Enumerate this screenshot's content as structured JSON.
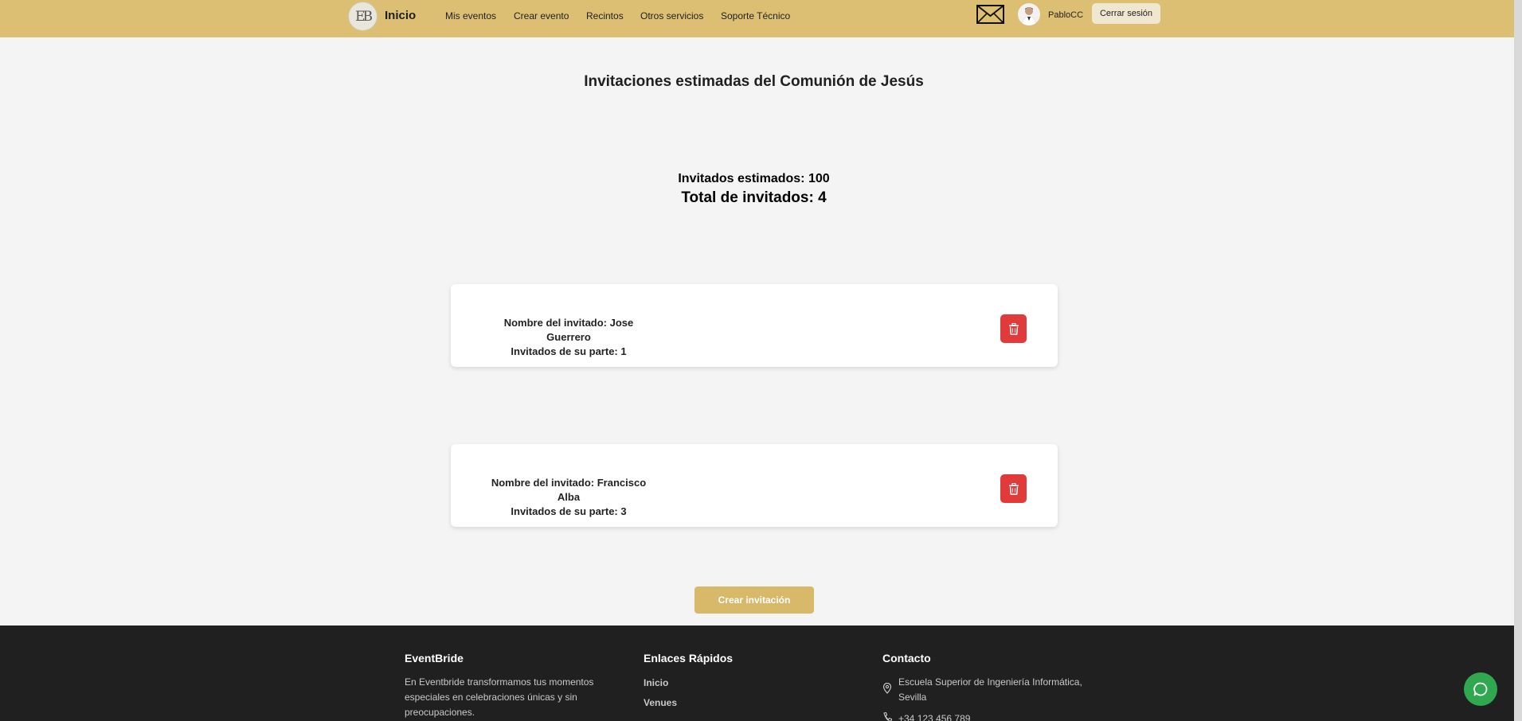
{
  "nav": {
    "logo_text": "EB",
    "home": "Inicio",
    "links": [
      "Mis eventos",
      "Crear evento",
      "Recintos",
      "Otros servicios",
      "Soporte Técnico"
    ],
    "username": "PabloCC",
    "logout": "Cerrar sesión"
  },
  "main": {
    "title": "Invitaciones estimadas del Comunión de Jesús",
    "estimated_guests": "Invitados estimados: 100",
    "total_guests": "Total de invitados: 4",
    "invitations": [
      {
        "name_line": "Nombre del invitado: Jose Guerrero",
        "party_line": "Invitados de su parte: 1"
      },
      {
        "name_line": "Nombre del invitado: Francisco Alba",
        "party_line": "Invitados de su parte: 3"
      }
    ],
    "create_button": "Crear invitación"
  },
  "footer": {
    "brand_title": "EventBride",
    "brand_text": [
      "En Eventbride transformamos tus momentos",
      "especiales en celebraciones únicas y sin",
      "preocupaciones."
    ],
    "links_title": "Enlaces Rápidos",
    "links": [
      "Inicio",
      "Venues"
    ],
    "contact_title": "Contacto",
    "address": [
      "Escuela Superior de Ingeniería Informática,",
      "Sevilla"
    ],
    "phone": "+34 123 456 789"
  },
  "colors": {
    "navbar": "#dcbf72",
    "delete": "#e13a3a",
    "create": "#d8b96a",
    "footer": "#202020",
    "chat": "#2fa84f"
  },
  "icons": [
    "mail-icon",
    "trash-icon",
    "location-icon",
    "phone-icon",
    "chat-icon"
  ]
}
